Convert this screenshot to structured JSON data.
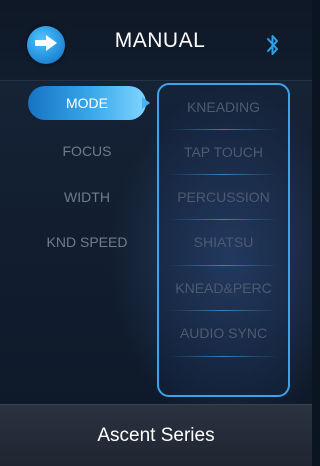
{
  "header": {
    "title": "MANUAL",
    "back_icon": "arrow-right-icon",
    "bluetooth_icon": "bluetooth-icon"
  },
  "menu": {
    "items": [
      {
        "label": "MODE",
        "active": true
      },
      {
        "label": "FOCUS",
        "active": false
      },
      {
        "label": "WIDTH",
        "active": false
      },
      {
        "label": "KND SPEED",
        "active": false
      }
    ],
    "active_indicator_icon": "triangle-right-icon"
  },
  "options": {
    "items": [
      {
        "label": "KNEADING"
      },
      {
        "label": "TAP TOUCH"
      },
      {
        "label": "PERCUSSION"
      },
      {
        "label": "SHIATSU"
      },
      {
        "label": "KNEAD&PERC"
      },
      {
        "label": "AUDIO SYNC"
      }
    ]
  },
  "footer": {
    "label": "Ascent Series"
  },
  "colors": {
    "accent": "#3aa9ea",
    "panel_border": "#3aa4e6",
    "inactive_text": "#6f7c8e",
    "option_text": "#4d5b70"
  }
}
